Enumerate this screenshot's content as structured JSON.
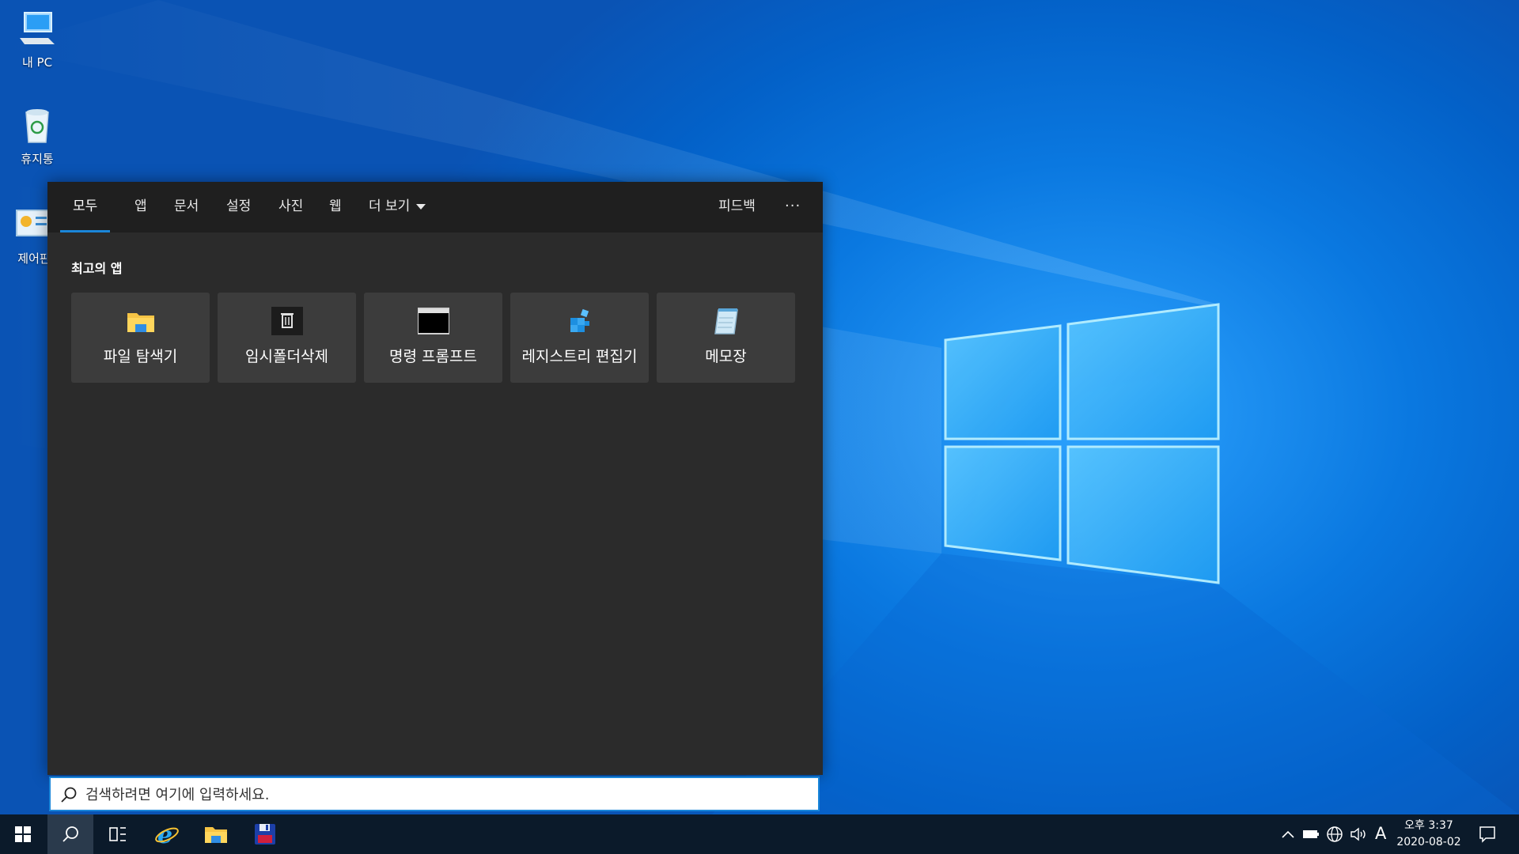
{
  "desktop": {
    "icons": [
      {
        "label": "내 PC",
        "icon": "computer-icon"
      },
      {
        "label": "휴지통",
        "icon": "recycle-bin-icon"
      },
      {
        "label": "제어판",
        "icon": "control-panel-icon"
      }
    ]
  },
  "search_panel": {
    "tabs": [
      {
        "label": "모두",
        "active": true
      },
      {
        "label": "앱"
      },
      {
        "label": "문서"
      },
      {
        "label": "설정"
      },
      {
        "label": "사진"
      },
      {
        "label": "웹"
      },
      {
        "label": "더 보기"
      }
    ],
    "feedback_label": "피드백",
    "more_options_label": "···",
    "section_title": "최고의 앱",
    "top_apps": [
      {
        "label": "파일 탐색기",
        "icon": "folder-icon"
      },
      {
        "label": "임시폴더삭제",
        "icon": "trash-icon"
      },
      {
        "label": "명령 프롬프트",
        "icon": "terminal-icon"
      },
      {
        "label": "레지스트리 편집기",
        "icon": "registry-icon"
      },
      {
        "label": "메모장",
        "icon": "notepad-icon"
      }
    ],
    "search_box": {
      "placeholder": "검색하려면 여기에 입력하세요.",
      "value": ""
    }
  },
  "taskbar": {
    "time": "오후 3:37",
    "date": "2020-08-02",
    "ime": "A",
    "accent_color": "#1a86d9"
  }
}
